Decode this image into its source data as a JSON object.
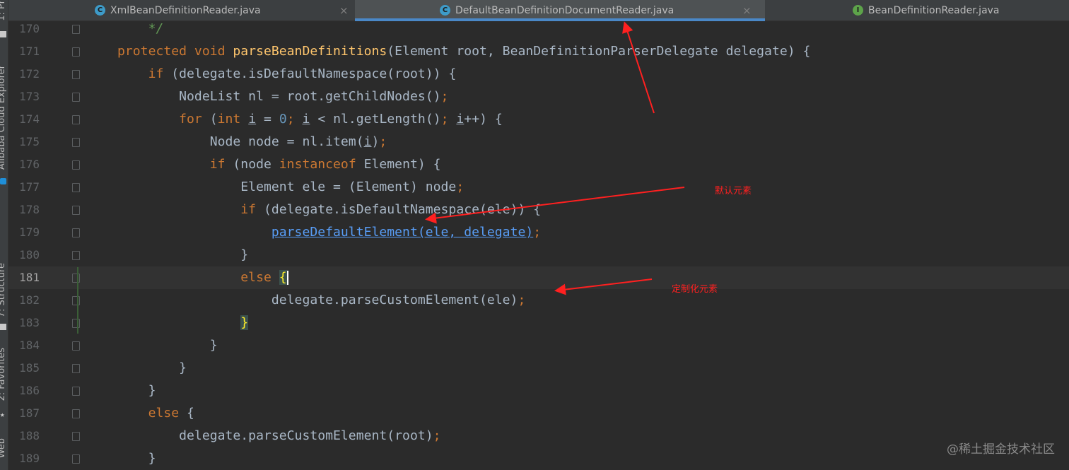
{
  "sidebar": {
    "tabs": [
      "1: Pr",
      "Alibaba Cloud Explorer",
      "7: Structure",
      "2: Favorites",
      "Web"
    ]
  },
  "tabs": [
    {
      "label": "XmlBeanDefinitionReader.java",
      "icon": "C",
      "icon_color": "#3d9bc9",
      "active": false
    },
    {
      "label": "DefaultBeanDefinitionDocumentReader.java",
      "icon": "C",
      "icon_color": "#3d9bc9",
      "active": true
    },
    {
      "label": "BeanDefinitionReader.java",
      "icon": "I",
      "icon_color": "#5da34a",
      "active": false
    }
  ],
  "editor": {
    "current_line": "181",
    "lines": [
      {
        "num": "170",
        "tokens": [
          [
            "cm",
            "    */"
          ]
        ]
      },
      {
        "num": "171",
        "tokens": [
          [
            "kw",
            "protected void "
          ],
          [
            "fn",
            "parseBeanDefinitions"
          ],
          [
            "t",
            "(Element root, BeanDefinitionParserDelegate delegate) {"
          ]
        ]
      },
      {
        "num": "172",
        "tokens": [
          [
            "kw",
            "    if "
          ],
          [
            "t",
            "(delegate.isDefaultNamespace(root)) {"
          ]
        ]
      },
      {
        "num": "173",
        "tokens": [
          [
            "t",
            "        NodeList nl = root.getChildNodes()"
          ],
          [
            "kw",
            ";"
          ]
        ]
      },
      {
        "num": "174",
        "tokens": [
          [
            "kw",
            "        for "
          ],
          [
            "t",
            "("
          ],
          [
            "kw",
            "int "
          ],
          [
            "ul",
            "i"
          ],
          [
            "t",
            " = "
          ],
          [
            "num",
            "0"
          ],
          [
            "kw",
            "; "
          ],
          [
            "ul",
            "i"
          ],
          [
            "t",
            " < nl.getLength()"
          ],
          [
            "kw",
            "; "
          ],
          [
            "ul",
            "i"
          ],
          [
            "t",
            "++) {"
          ]
        ]
      },
      {
        "num": "175",
        "tokens": [
          [
            "t",
            "            Node node = nl.item("
          ],
          [
            "ul",
            "i"
          ],
          [
            "t",
            ")"
          ],
          [
            "kw",
            ";"
          ]
        ]
      },
      {
        "num": "176",
        "tokens": [
          [
            "kw",
            "            if "
          ],
          [
            "t",
            "(node "
          ],
          [
            "kw",
            "instanceof "
          ],
          [
            "t",
            "Element) {"
          ]
        ]
      },
      {
        "num": "177",
        "tokens": [
          [
            "t",
            "                Element ele = (Element) node"
          ],
          [
            "kw",
            ";"
          ]
        ]
      },
      {
        "num": "178",
        "tokens": [
          [
            "kw",
            "                if "
          ],
          [
            "t",
            "(delegate.isDefaultNamespace(ele)) {"
          ]
        ]
      },
      {
        "num": "179",
        "tokens": [
          [
            "t",
            "                    "
          ],
          [
            "link",
            "parseDefaultElement(ele, delegate)"
          ],
          [
            "kw",
            ";"
          ]
        ]
      },
      {
        "num": "180",
        "tokens": [
          [
            "t",
            "                }"
          ]
        ]
      },
      {
        "num": "181",
        "tokens": [
          [
            "kw",
            "                else "
          ],
          [
            "hl",
            "{"
          ],
          [
            "caret",
            ""
          ]
        ]
      },
      {
        "num": "182",
        "tokens": [
          [
            "t",
            "                    delegate.parseCustomElement(ele)"
          ],
          [
            "kw",
            ";"
          ]
        ]
      },
      {
        "num": "183",
        "tokens": [
          [
            "t",
            "                "
          ],
          [
            "hl",
            "}"
          ]
        ]
      },
      {
        "num": "184",
        "tokens": [
          [
            "t",
            "            }"
          ]
        ]
      },
      {
        "num": "185",
        "tokens": [
          [
            "t",
            "        }"
          ]
        ]
      },
      {
        "num": "186",
        "tokens": [
          [
            "t",
            "    }"
          ]
        ]
      },
      {
        "num": "187",
        "tokens": [
          [
            "kw",
            "    else "
          ],
          [
            "t",
            "{"
          ]
        ]
      },
      {
        "num": "188",
        "tokens": [
          [
            "t",
            "        delegate.parseCustomElement(root)"
          ],
          [
            "kw",
            ";"
          ]
        ]
      },
      {
        "num": "189",
        "tokens": [
          [
            "t",
            "    }"
          ]
        ]
      }
    ]
  },
  "annotations": {
    "default_elements": "默认元素",
    "custom_elements": "定制化元素",
    "color": "#ff2020"
  },
  "watermark": "@稀土掘金技术社区"
}
